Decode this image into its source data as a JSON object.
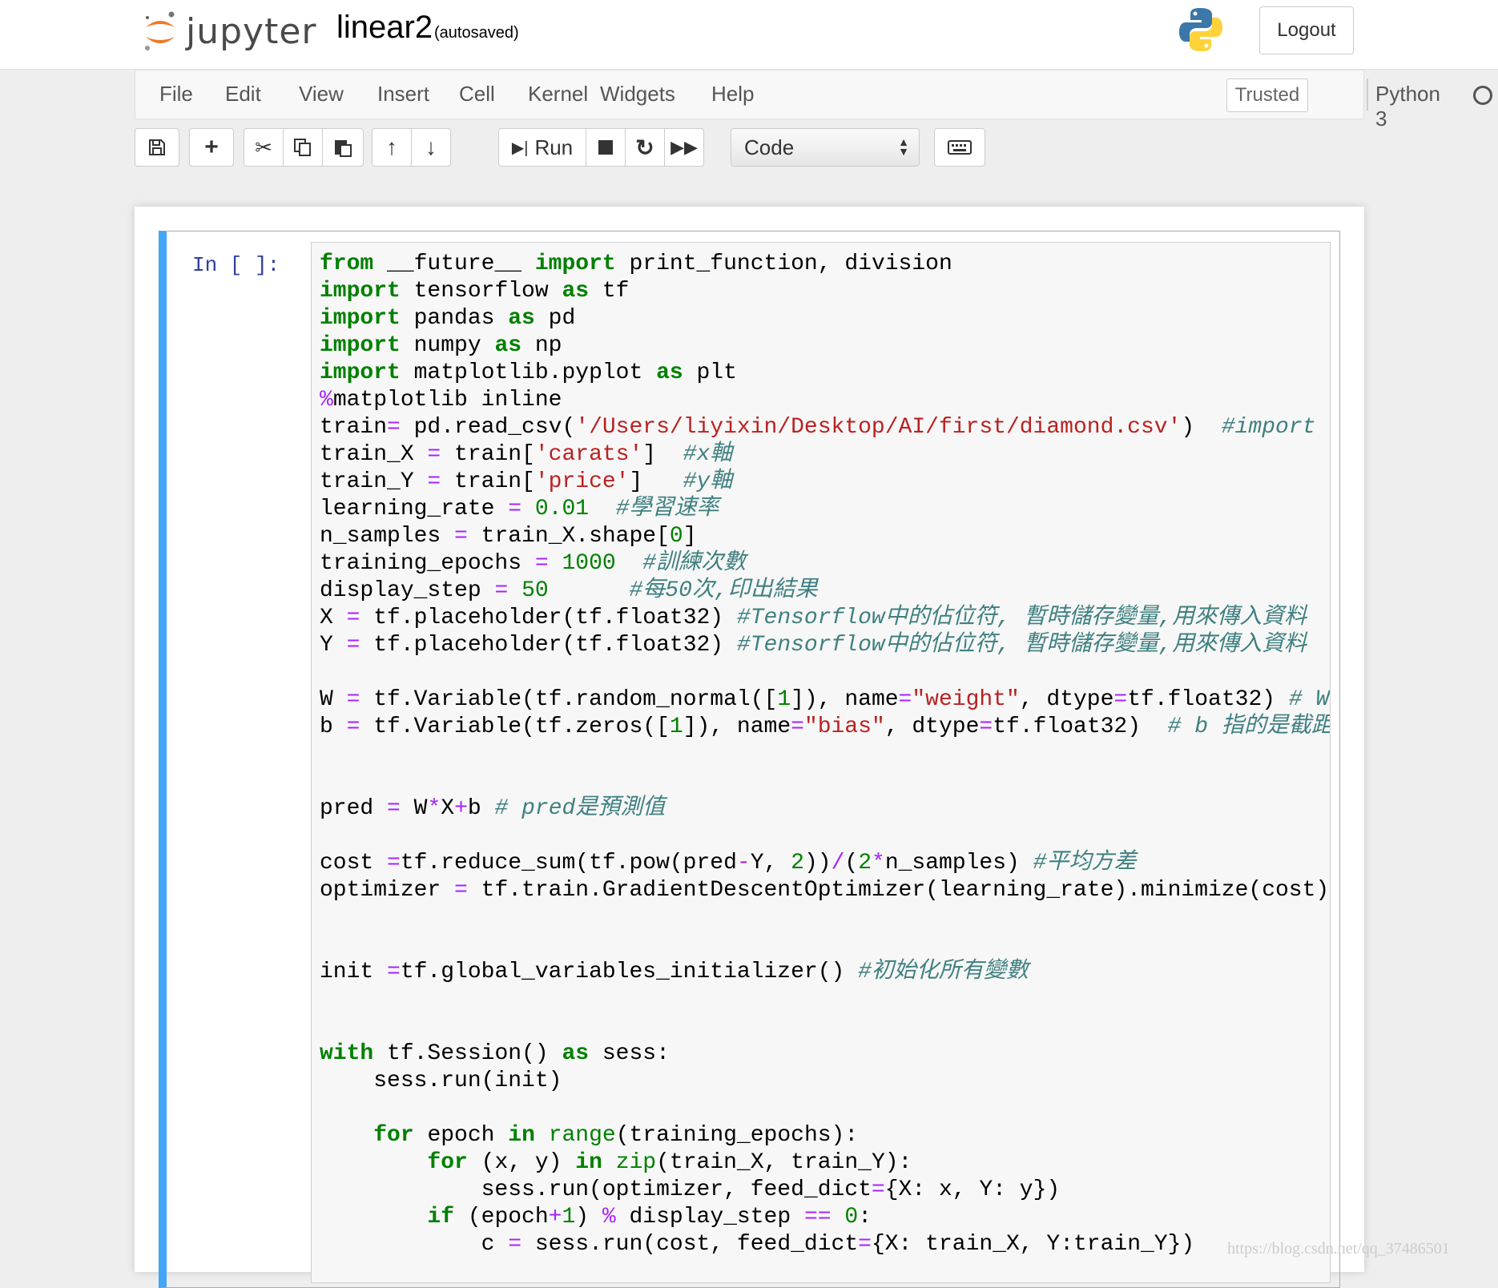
{
  "header": {
    "logo_text": "jupyter",
    "notebook_name": "linear2",
    "autosave_status": "(autosaved)",
    "logout_label": "Logout"
  },
  "menubar": {
    "items": [
      "File",
      "Edit",
      "View",
      "Insert",
      "Cell",
      "Kernel",
      "Widgets",
      "Help"
    ],
    "trusted_label": "Trusted",
    "kernel_name": "Python 3"
  },
  "toolbar": {
    "run_label": "Run",
    "cell_type": "Code",
    "icons": [
      "save-icon",
      "plus-icon",
      "scissors-icon",
      "copy-icon",
      "paste-icon",
      "arrow-up-icon",
      "arrow-down-icon",
      "run-icon",
      "stop-icon",
      "restart-icon",
      "fast-forward-icon",
      "keyboard-icon"
    ]
  },
  "cell": {
    "prompt": "In [ ]:",
    "lines": [
      "from __future__ import print_function, division",
      "import tensorflow as tf",
      "import pandas as pd",
      "import numpy as np",
      "import matplotlib.pyplot as plt",
      "%matplotlib inline",
      "train= pd.read_csv('/Users/liyixin/Desktop/AI/first/diamond.csv')  #import",
      "train_X = train['carats']  #x軸",
      "train_Y = train['price']   #y軸",
      "learning_rate = 0.01  #學習速率",
      "n_samples = train_X.shape[0]",
      "training_epochs = 1000  #訓練次數",
      "display_step = 50      #每50次,印出結果",
      "X = tf.placeholder(tf.float32) #Tensorflow中的佔位符, 暫時儲存變量,用來傳入資料",
      "Y = tf.placeholder(tf.float32) #Tensorflow中的佔位符, 暫時儲存變量,用來傳入資料",
      "",
      "W = tf.Variable(tf.random_normal([1]), name=\"weight\", dtype=tf.float32) # W",
      "b = tf.Variable(tf.zeros([1]), name=\"bias\", dtype=tf.float32)  # b 指的是截距",
      "",
      "",
      "pred = W*X+b # pred是預測值",
      "",
      "cost =tf.reduce_sum(tf.pow(pred-Y, 2))/(2*n_samples) #平均方差",
      "optimizer = tf.train.GradientDescentOptimizer(learning_rate).minimize(cost)",
      "",
      "",
      "init =tf.global_variables_initializer() #初始化所有變數",
      "",
      "",
      "with tf.Session() as sess:",
      "    sess.run(init)",
      "",
      "    for epoch in range(training_epochs):",
      "        for (x, y) in zip(train_X, train_Y):",
      "            sess.run(optimizer, feed_dict={X: x, Y: y})",
      "        if (epoch+1) % display_step == 0:",
      "            c = sess.run(cost, feed_dict={X: train_X, Y:train_Y})"
    ]
  },
  "watermark": "https://blog.csdn.net/qq_37486501",
  "colors": {
    "keyword": "#008000",
    "operator": "#aa22ff",
    "string": "#ba2121",
    "comment": "#408080",
    "prompt": "#303f9f",
    "cell_selected_border": "#42a5f5"
  }
}
